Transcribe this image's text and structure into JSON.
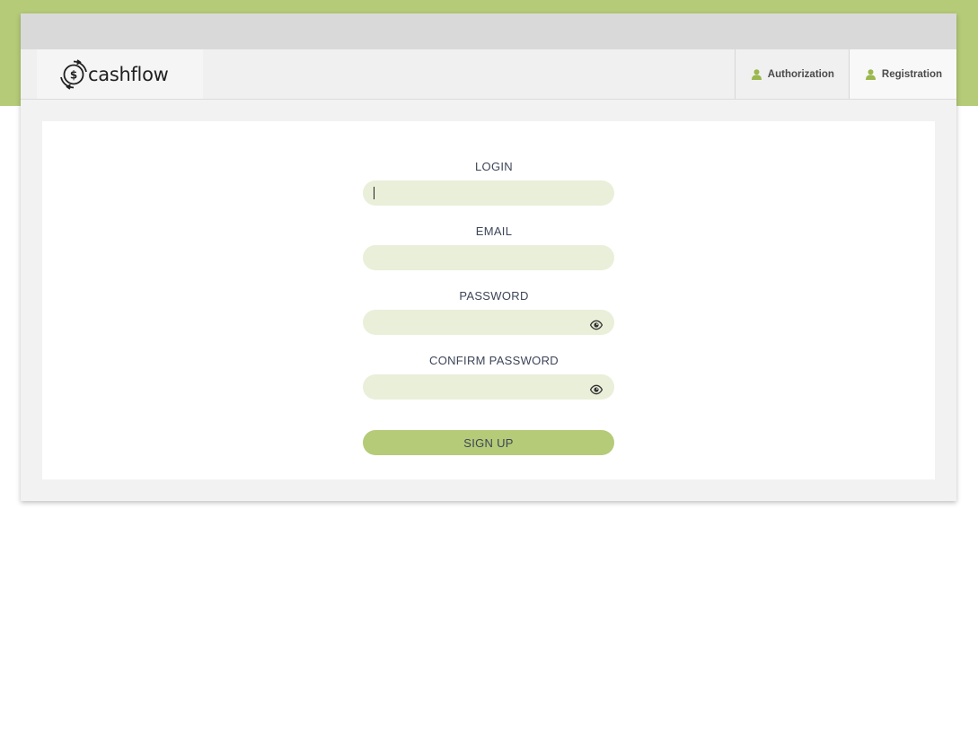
{
  "brand": {
    "name": "cashflow",
    "logo_icon": "dollar-circle-arrows-icon"
  },
  "nav": {
    "items": [
      {
        "label": "Authorization",
        "icon": "user-icon",
        "active": false
      },
      {
        "label": "Registration",
        "icon": "user-icon",
        "active": true
      }
    ]
  },
  "form": {
    "login": {
      "label": "LOGIN",
      "value": "",
      "placeholder": ""
    },
    "email": {
      "label": "EMAIL",
      "value": "",
      "placeholder": ""
    },
    "password": {
      "label": "PASSWORD",
      "value": "",
      "placeholder": "",
      "toggle_icon": "eye-icon"
    },
    "confirm_password": {
      "label": "CONFIRM PASSWORD",
      "value": "",
      "placeholder": "",
      "toggle_icon": "eye-icon"
    },
    "submit_label": "SIGN UP"
  },
  "colors": {
    "accent": "#b5cb77",
    "input_bg": "#e9efd9",
    "label_text": "#3d4558"
  }
}
